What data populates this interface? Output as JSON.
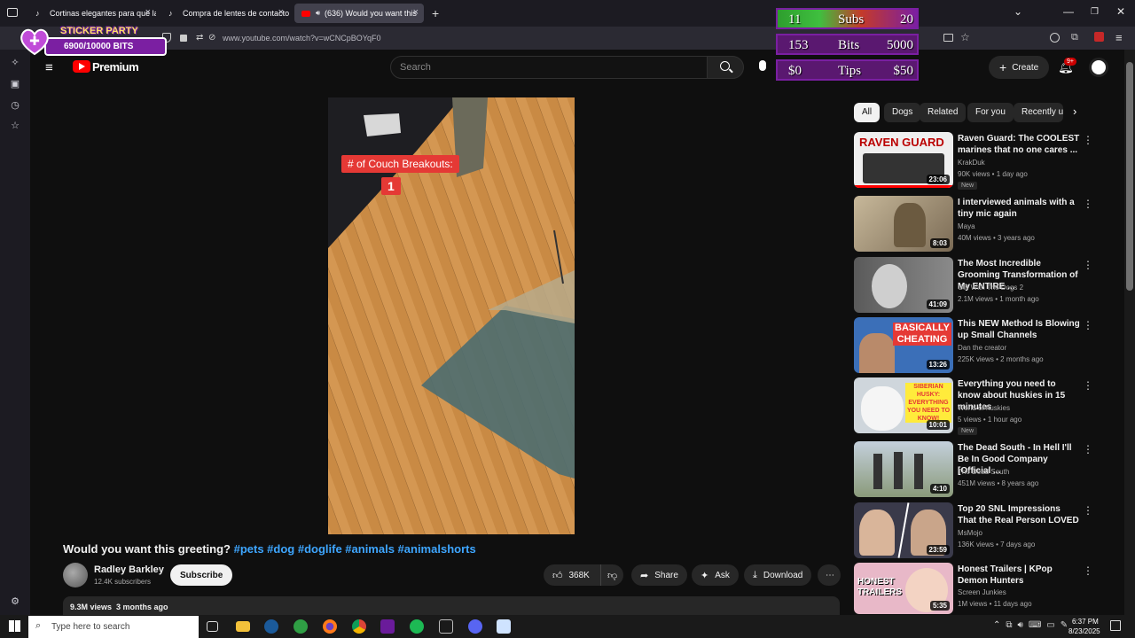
{
  "tabs": [
    {
      "label": "Cortinas elegantes para que la"
    },
    {
      "label": "Compra de lentes de contacto"
    },
    {
      "label": "(636) Would you want this"
    }
  ],
  "url": "www.youtube.com/watch?v=wCNCpBOYqF0",
  "sticker": {
    "title": "STICKER PARTY",
    "bits": "6900/10000 BITS"
  },
  "goals": [
    {
      "left": "11",
      "label": "Subs",
      "right": "20",
      "color": "#2e9e2e"
    },
    {
      "left": "153",
      "label": "Bits",
      "right": "5000",
      "color": "#5a1870"
    },
    {
      "left": "$0",
      "label": "Tips",
      "right": "$50",
      "color": "#5a1870"
    }
  ],
  "yt": {
    "logo": "Premium",
    "search_placeholder": "Search",
    "create_label": "Create",
    "notif_badge": "9+"
  },
  "video": {
    "overlay_title": "# of Couch Breakouts:",
    "overlay_count": "1",
    "title": "Would you want this greeting?",
    "tags": "#pets #dog #doglife #animals #animalshorts",
    "channel": "Radley Barkley",
    "subs": "12.4K subscribers",
    "subscribe": "Subscribe",
    "likes": "368K",
    "share": "Share",
    "ask": "Ask",
    "download": "Download",
    "stats": "9.3M views  3 months ago"
  },
  "chips": [
    "All",
    "Dogs",
    "Related",
    "For you",
    "Recently u"
  ],
  "recs": [
    {
      "title": "Raven Guard: The COOLEST marines that no one cares ...",
      "channel": "KrakDuk",
      "meta": "90K views • 1 day ago",
      "badge": "New",
      "dur": "23:06",
      "thumb_text": "RAVEN GUARD",
      "thumb_color": "#efefef"
    },
    {
      "title": "I interviewed animals with a tiny mic again",
      "channel": "Maya",
      "meta": "40M views • 3 years ago",
      "badge": "",
      "dur": "8:03",
      "thumb_text": "",
      "thumb_color": "#8a7a60"
    },
    {
      "title": "The Most Incredible Grooming Transformation of My ENTIRE ...",
      "channel": "Girl With The Dogs 2",
      "meta": "2.1M views • 1 month ago",
      "badge": "",
      "dur": "41:09",
      "thumb_text": "",
      "thumb_color": "#6f6f6f"
    },
    {
      "title": "This NEW Method Is Blowing up Small Channels",
      "channel": "Dan the creator",
      "meta": "225K views • 2 months ago",
      "badge": "",
      "dur": "13:26",
      "thumb_text": "BASICALLY CHEATING",
      "thumb_color": "#3b6fb8"
    },
    {
      "title": "Everything you need to know about huskies in 15 minutes",
      "channel": "World of huskies",
      "meta": "5 views • 1 hour ago",
      "badge": "New",
      "dur": "10:01",
      "thumb_text": "SIBERIAN HUSKY: EVERYTHING YOU NEED TO KNOW!",
      "thumb_color": "#cfd6dc"
    },
    {
      "title": "The Dead South - In Hell I'll Be In Good Company [Official ...",
      "channel": "The Dead South",
      "meta": "451M views • 8 years ago",
      "badge": "",
      "dur": "4:10",
      "thumb_text": "",
      "thumb_color": "#8a9a7a"
    },
    {
      "title": "Top 20 SNL Impressions That the Real Person LOVED",
      "channel": "MsMojo",
      "meta": "136K views • 7 days ago",
      "badge": "",
      "dur": "23:59",
      "thumb_text": "",
      "thumb_color": "#5a5a6a"
    },
    {
      "title": "Honest Trailers | KPop Demon Hunters",
      "channel": "Screen Junkies",
      "meta": "1M views • 11 days ago",
      "badge": "",
      "dur": "5:35",
      "thumb_text": "HONEST TRAILERS",
      "thumb_color": "#e8b8c8"
    }
  ],
  "taskbar": {
    "search_placeholder": "Type here to search",
    "time": "6:37 PM",
    "date": "8/23/2025"
  }
}
